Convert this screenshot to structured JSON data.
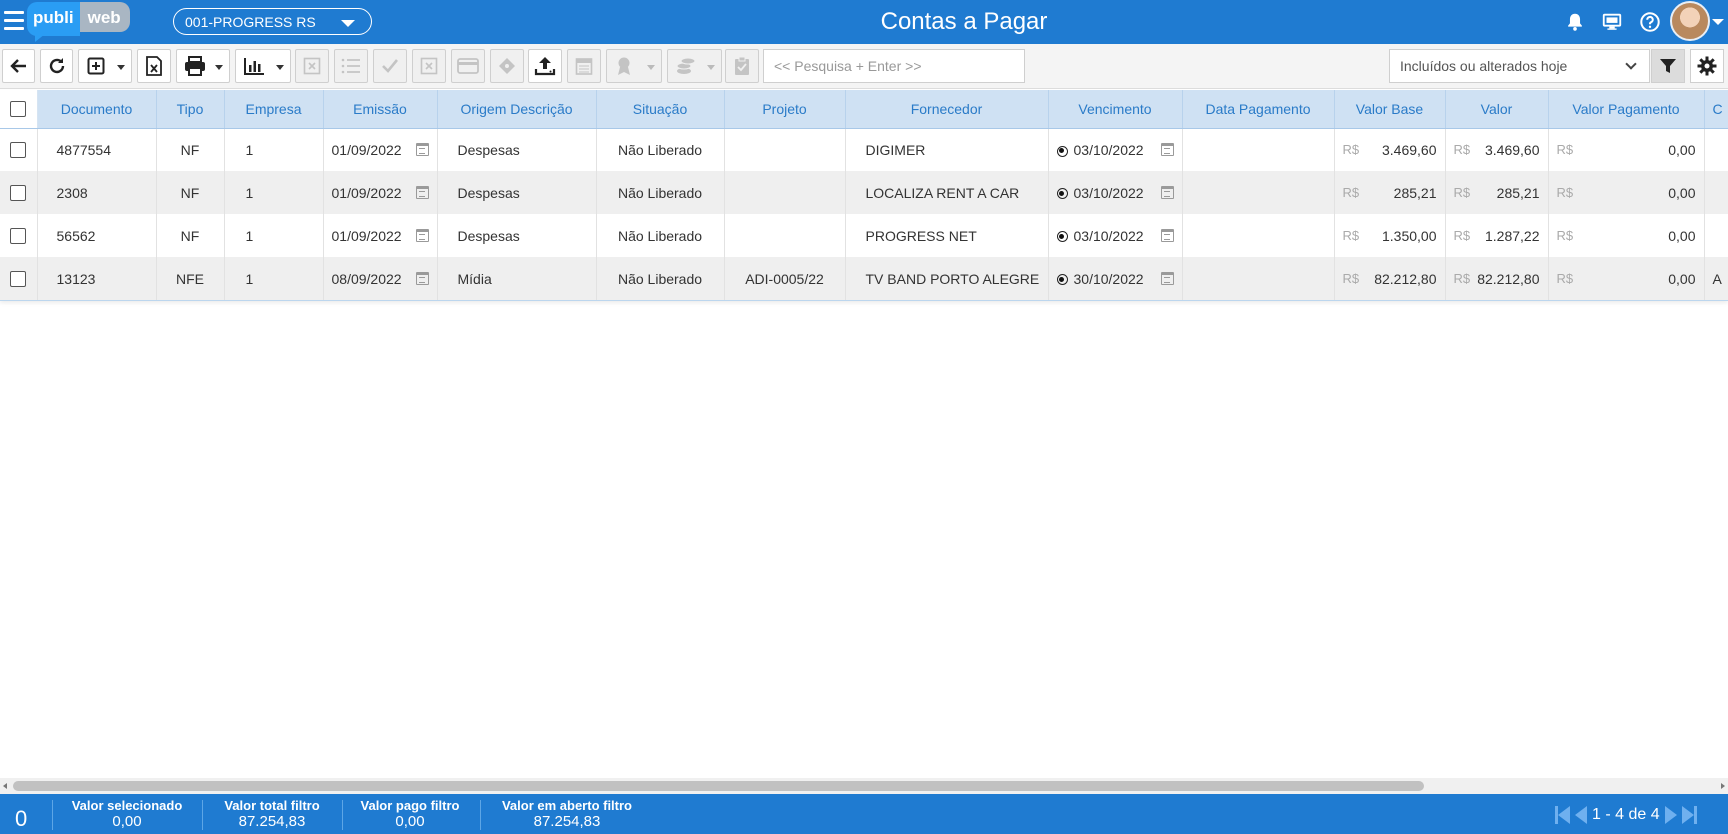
{
  "app": {
    "logo_part1": "publi",
    "logo_part2": "web",
    "company": "001-PROGRESS RS",
    "title": "Contas a Pagar"
  },
  "toolbar": {
    "search_placeholder": "<< Pesquisa + Enter >>",
    "filter_selected": "Incluídos ou alterados hoje"
  },
  "grid": {
    "columns": [
      "Documento",
      "Tipo",
      "Empresa",
      "Emissão",
      "Origem Descrição",
      "Situação",
      "Projeto",
      "Fornecedor",
      "Vencimento",
      "Data Pagamento",
      "Valor Base",
      "Valor",
      "Valor Pagamento",
      "C"
    ],
    "currency": "R$",
    "rows": [
      {
        "documento": "4877554",
        "tipo": "NF",
        "empresa": "1",
        "emissao": "01/09/2022",
        "origem": "Despesas",
        "situacao": "Não Liberado",
        "projeto": "",
        "fornecedor": "DIGIMER",
        "vencimento": "03/10/2022",
        "data_pagamento": "",
        "valor_base": "3.469,60",
        "valor": "3.469,60",
        "valor_pagamento": "0,00",
        "extra": ""
      },
      {
        "documento": "2308",
        "tipo": "NF",
        "empresa": "1",
        "emissao": "01/09/2022",
        "origem": "Despesas",
        "situacao": "Não Liberado",
        "projeto": "",
        "fornecedor": "LOCALIZA RENT A CAR",
        "vencimento": "03/10/2022",
        "data_pagamento": "",
        "valor_base": "285,21",
        "valor": "285,21",
        "valor_pagamento": "0,00",
        "extra": ""
      },
      {
        "documento": "56562",
        "tipo": "NF",
        "empresa": "1",
        "emissao": "01/09/2022",
        "origem": "Despesas",
        "situacao": "Não Liberado",
        "projeto": "",
        "fornecedor": "PROGRESS NET",
        "vencimento": "03/10/2022",
        "data_pagamento": "",
        "valor_base": "1.350,00",
        "valor": "1.287,22",
        "valor_pagamento": "0,00",
        "extra": ""
      },
      {
        "documento": "13123",
        "tipo": "NFE",
        "empresa": "1",
        "emissao": "08/09/2022",
        "origem": "Mídia",
        "situacao": "Não Liberado",
        "projeto": "ADI-0005/22",
        "fornecedor": "TV BAND PORTO ALEGRE",
        "vencimento": "30/10/2022",
        "data_pagamento": "",
        "valor_base": "82.212,80",
        "valor": "82.212,80",
        "valor_pagamento": "0,00",
        "extra": "A"
      }
    ]
  },
  "footer": {
    "selected_count": "0",
    "stats": [
      {
        "label": "Valor selecionado",
        "value": "0,00"
      },
      {
        "label": "Valor total filtro",
        "value": "87.254,83"
      },
      {
        "label": "Valor pago filtro",
        "value": "0,00"
      },
      {
        "label": "Valor em aberto filtro",
        "value": "87.254,83"
      }
    ],
    "pagination": "1 - 4 de 4"
  },
  "colors": {
    "primary": "#1f7bd1",
    "header_bg": "#cfe1f3",
    "header_text": "#2a7bc8"
  },
  "icons": [
    "menu-icon",
    "bell-icon",
    "monitor-icon",
    "help-icon",
    "back-icon",
    "refresh-icon",
    "add-icon",
    "excel-icon",
    "print-icon",
    "chart-icon",
    "filter-icon",
    "gear-icon",
    "calendar-icon",
    "upload-icon"
  ]
}
